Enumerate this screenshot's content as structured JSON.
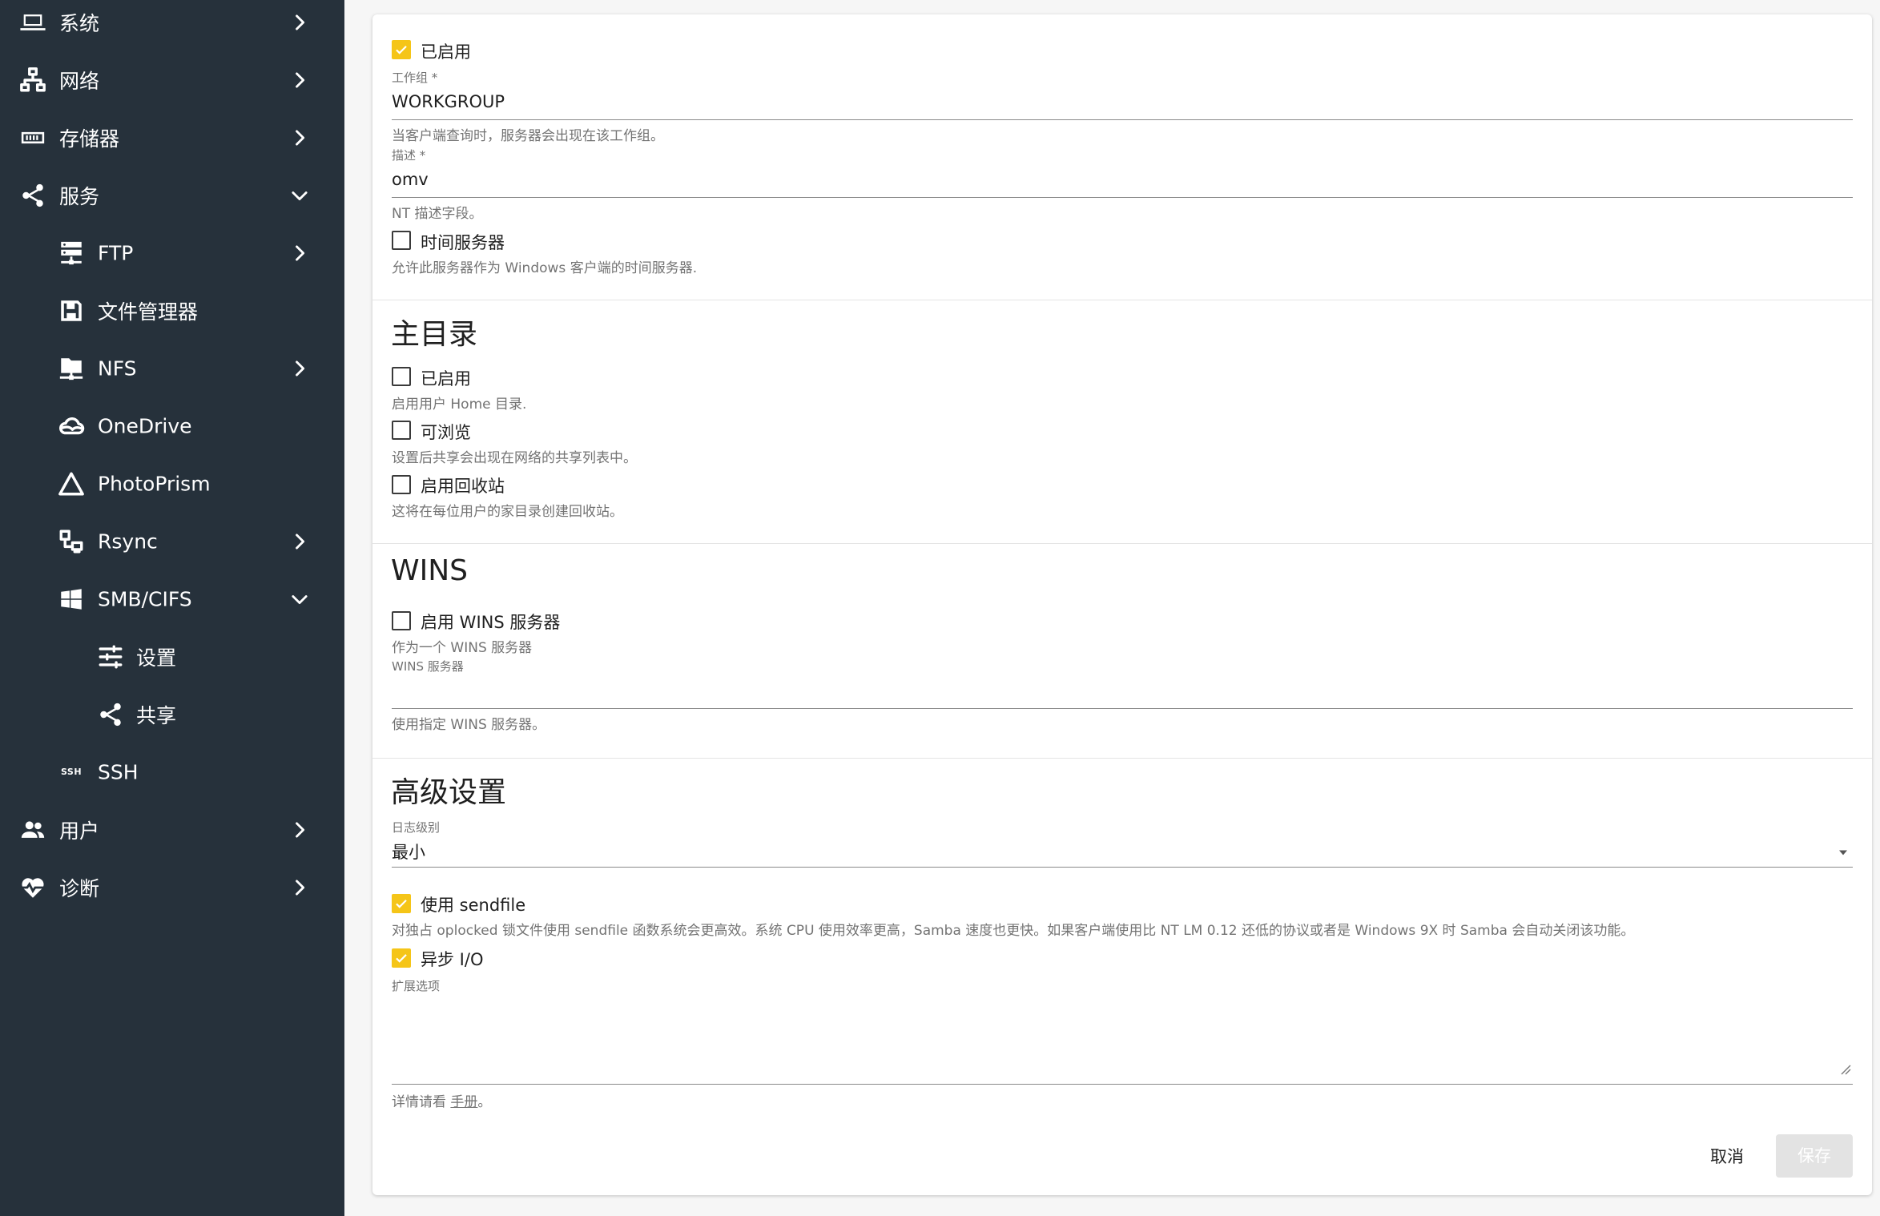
{
  "sidebar": {
    "items": [
      {
        "label": "系统",
        "icon": "laptop-icon",
        "expanded": false
      },
      {
        "label": "网络",
        "icon": "network-icon",
        "expanded": false
      },
      {
        "label": "存储器",
        "icon": "storage-icon",
        "expanded": false
      },
      {
        "label": "服务",
        "icon": "share-icon",
        "expanded": true
      },
      {
        "label": "FTP",
        "icon": "server-icon",
        "expanded": false
      },
      {
        "label": "文件管理器",
        "icon": "floppy-icon"
      },
      {
        "label": "NFS",
        "icon": "folder-network-icon",
        "expanded": false
      },
      {
        "label": "OneDrive",
        "icon": "cloud-icon"
      },
      {
        "label": "PhotoPrism",
        "icon": "triangle-icon"
      },
      {
        "label": "Rsync",
        "icon": "sync-icon",
        "expanded": false
      },
      {
        "label": "SMB/CIFS",
        "icon": "windows-icon",
        "expanded": true
      },
      {
        "label": "设置",
        "icon": "tune-icon"
      },
      {
        "label": "共享",
        "icon": "share-icon"
      },
      {
        "label": "SSH",
        "icon": "ssh-icon"
      },
      {
        "label": "用户",
        "icon": "users-icon",
        "expanded": false
      },
      {
        "label": "诊断",
        "icon": "heart-pulse-icon",
        "expanded": false
      }
    ],
    "ssh_badge": "SSH"
  },
  "general": {
    "enabled": {
      "label": "已启用",
      "checked": true
    },
    "workgroup": {
      "label": "工作组 *",
      "value": "WORKGROUP",
      "hint": "当客户端查询时，服务器会出现在该工作组。"
    },
    "description": {
      "label": "描述 *",
      "value": "omv",
      "hint": "NT 描述字段。"
    },
    "time_server": {
      "label": "时间服务器",
      "checked": false,
      "hint": "允许此服务器作为 Windows 客户端的时间服务器."
    }
  },
  "home": {
    "title": "主目录",
    "enabled": {
      "label": "已启用",
      "checked": false,
      "hint": "启用用户 Home 目录."
    },
    "browseable": {
      "label": "可浏览",
      "checked": false,
      "hint": "设置后共享会出现在网络的共享列表中。"
    },
    "recycle": {
      "label": "启用回收站",
      "checked": false,
      "hint": "这将在每位用户的家目录创建回收站。"
    }
  },
  "wins": {
    "title": "WINS",
    "enable": {
      "label": "启用 WINS 服务器",
      "checked": false,
      "hint": "作为一个 WINS 服务器"
    },
    "server": {
      "label": "WINS 服务器",
      "value": "",
      "hint": "使用指定 WINS 服务器。"
    }
  },
  "advanced": {
    "title": "高级设置",
    "log_level": {
      "label": "日志级别",
      "value": "最小"
    },
    "sendfile": {
      "label": "使用 sendfile",
      "checked": true,
      "hint": "对独占 oplocked 锁文件使用 sendfile 函数系统会更高效。系统 CPU 使用效率更高，Samba 速度也更快。如果客户端使用比 NT LM 0.12 还低的协议或者是 Windows 9X 时 Samba 会自动关闭该功能。"
    },
    "async_io": {
      "label": "异步 I/O",
      "checked": true
    },
    "extra_options": {
      "label": "扩展选项",
      "value": "",
      "hint_prefix": "详情请看",
      "hint_link": "手册",
      "hint_suffix": "。"
    }
  },
  "actions": {
    "cancel": "取消",
    "save": "保存"
  },
  "colors": {
    "sidebar_bg": "#26313b",
    "checkbox_accent": "#f5c518",
    "page_bg": "#f6f6f6"
  }
}
